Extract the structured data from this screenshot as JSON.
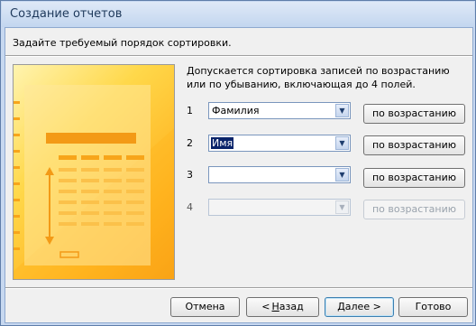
{
  "window": {
    "title": "Создание отчетов"
  },
  "header": {
    "text": "Задайте требуемый порядок сортировки."
  },
  "description": "Допускается сортировка записей по возрастанию или по убыванию, включающая до 4 полей.",
  "sort_rows": [
    {
      "num": "1",
      "field": "Фамилия",
      "order": "по возрастанию",
      "enabled": true
    },
    {
      "num": "2",
      "field": "Имя",
      "order": "по возрастанию",
      "enabled": true,
      "selected": true
    },
    {
      "num": "3",
      "field": "",
      "order": "по возрастанию",
      "enabled": true
    },
    {
      "num": "4",
      "field": "",
      "order": "по возрастанию",
      "enabled": false
    }
  ],
  "footer": {
    "cancel": "Отмена",
    "back_arrow": "<",
    "back_mnemonic": "Н",
    "back_rest": "азад",
    "next_mnemonic": "Д",
    "next_rest": "алее",
    "next_arrow": ">",
    "finish": "Готово"
  },
  "icons": {
    "dropdown": "chevron-down-icon",
    "illustration": "report-illustration"
  },
  "colors": {
    "title_text": "#1e395b",
    "illustration": "#ffc93a",
    "selection": "#0a246a"
  }
}
